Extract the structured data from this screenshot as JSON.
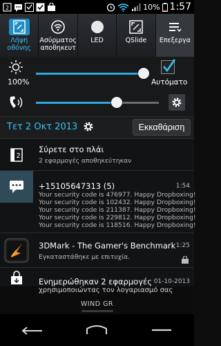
{
  "status_bar": {
    "battery": "10%",
    "time": "1:57"
  },
  "quick_settings": [
    {
      "label": "Λήψη\nοθόνης",
      "icon": "screenshot-icon",
      "active": true
    },
    {
      "label": "Ασύρματος\nαποθηκευτ",
      "icon": "wireless-storage-icon",
      "active": false
    },
    {
      "label": "LED",
      "icon": "led-icon",
      "active": false
    },
    {
      "label": "QSlide",
      "icon": "qslide-icon",
      "active": false
    },
    {
      "label": "Επεξεργα",
      "icon": "edit-icon",
      "active": false
    }
  ],
  "brightness": {
    "label": "100%",
    "level": 1.0,
    "auto_label": "Αυτόματο",
    "auto_checked": true
  },
  "volume": {
    "level": 0.66
  },
  "date_row": {
    "date": "Τετ 2 Οκτ 2013",
    "clear_label": "Εκκαθάριση"
  },
  "notifications": [
    {
      "title": "Σύρετε στο πλάι",
      "subtitle": "2 εφαρμογές αποθηκεύτηκαν",
      "time": "",
      "icon": "qslide-notification-icon"
    },
    {
      "title": "+15105647313  (5)",
      "lines": [
        "Your security code is 476977. Happy Dropboxing!",
        "Your security code is 102432. Happy Dropboxing!",
        "Your security code is 211387. Happy Dropboxing!",
        "Your security code is 229812. Happy Dropboxing!",
        "Your security code is 118516. Happy Dropboxing!"
      ],
      "time": "1:54",
      "icon": "message-icon"
    },
    {
      "title": "3DMark - The Gamer's Benchmark",
      "subtitle": "Εγκαταστάθηκε με επιτυχία.",
      "time": "1:25",
      "icon": "3dmark-app-icon"
    },
    {
      "title": "Ενημερώθηκαν 2 εφαρμογές",
      "time": "01-10-2013",
      "icon": "store-icon"
    }
  ],
  "carrier": {
    "ghost_text": "χρησιμοποιώντας τον λογαριασμό σας",
    "name": "WIND GR"
  },
  "colors": {
    "accent": "#39c3f4",
    "slider_fill": "#2ea9e0"
  }
}
